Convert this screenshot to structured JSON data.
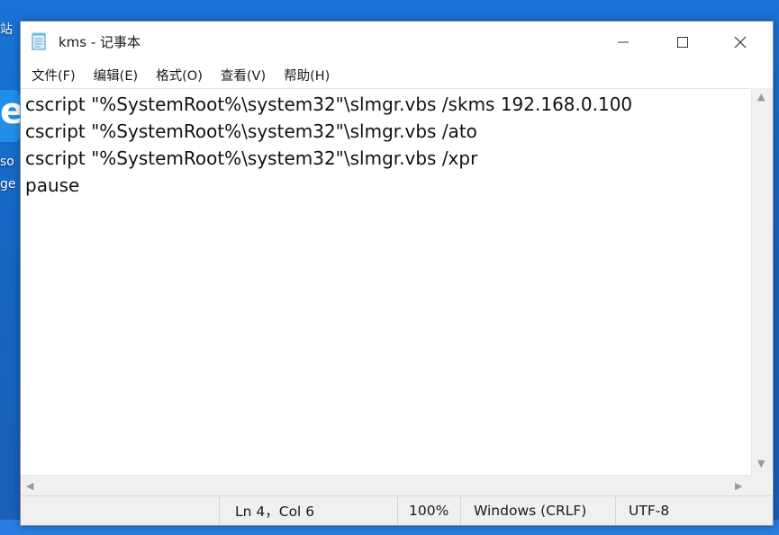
{
  "desktop": {
    "fragment1": "站",
    "fragment2": "so",
    "fragment3": "ge",
    "edge_glyph": "e"
  },
  "window": {
    "title": "kms - 记事本"
  },
  "menu": [
    {
      "label": "文件(F)"
    },
    {
      "label": "编辑(E)"
    },
    {
      "label": "格式(O)"
    },
    {
      "label": "查看(V)"
    },
    {
      "label": "帮助(H)"
    }
  ],
  "editor": {
    "lines": [
      "cscript \"%SystemRoot%\\system32\"\\slmgr.vbs /skms 192.168.0.100",
      "cscript \"%SystemRoot%\\system32\"\\slmgr.vbs /ato",
      "cscript \"%SystemRoot%\\system32\"\\slmgr.vbs /xpr",
      "pause"
    ]
  },
  "status": {
    "position": "Ln 4，Col 6",
    "zoom": "100%",
    "line_ending": "Windows (CRLF)",
    "encoding": "UTF-8"
  },
  "icons": {
    "app": "notepad-icon",
    "minimize": "minimize-icon",
    "maximize": "maximize-icon",
    "close": "close-icon"
  }
}
